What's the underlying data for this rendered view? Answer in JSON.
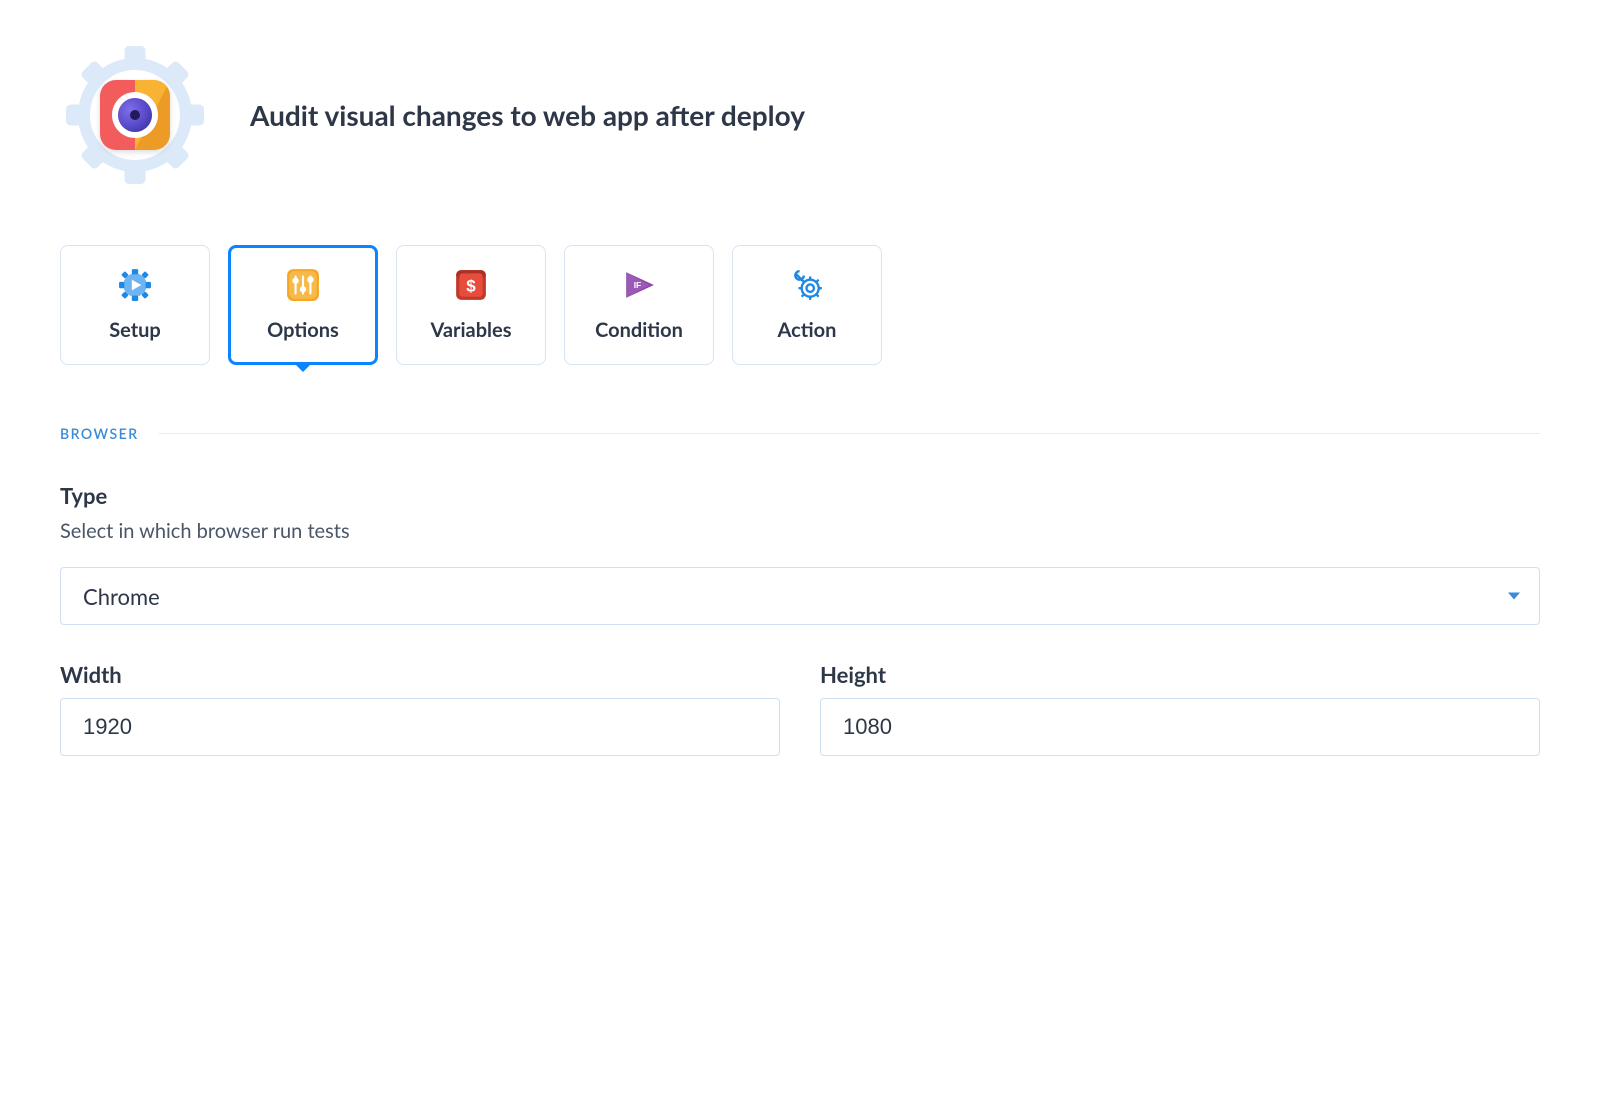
{
  "header": {
    "title": "Audit visual changes to web app after deploy"
  },
  "tabs": [
    {
      "label": "Setup",
      "icon": "gear-play-icon",
      "active": false
    },
    {
      "label": "Options",
      "icon": "sliders-icon",
      "active": true
    },
    {
      "label": "Variables",
      "icon": "dollar-box-icon",
      "active": false
    },
    {
      "label": "Condition",
      "icon": "if-play-icon",
      "active": false
    },
    {
      "label": "Action",
      "icon": "gear-wrench-icon",
      "active": false
    }
  ],
  "section": {
    "heading": "BROWSER",
    "type": {
      "label": "Type",
      "description": "Select in which browser run tests",
      "value": "Chrome"
    },
    "width": {
      "label": "Width",
      "value": "1920"
    },
    "height": {
      "label": "Height",
      "value": "1080"
    }
  }
}
